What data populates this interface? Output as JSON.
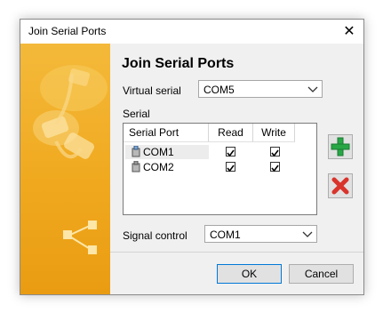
{
  "window": {
    "title": "Join Serial Ports",
    "close_label": "✕"
  },
  "panel": {
    "title": "Join Serial Ports"
  },
  "virtual_serial": {
    "label": "Virtual serial",
    "value": "COM5"
  },
  "serial_group": {
    "label": "Serial",
    "columns": [
      "Serial Port",
      "Read",
      "Write"
    ],
    "rows": [
      {
        "port": "COM1",
        "read": true,
        "write": true
      },
      {
        "port": "COM2",
        "read": true,
        "write": true
      }
    ]
  },
  "signal_control": {
    "label": "Signal control",
    "value": "COM1"
  },
  "buttons": {
    "ok": "OK",
    "cancel": "Cancel"
  },
  "icons": {
    "add": "plus-icon",
    "remove": "x-icon",
    "port": "serial-port-icon",
    "close": "close-icon"
  },
  "colors": {
    "banner": "#f0a91f",
    "add": "#28a745",
    "remove": "#d9342b",
    "accent": "#0078d7"
  }
}
